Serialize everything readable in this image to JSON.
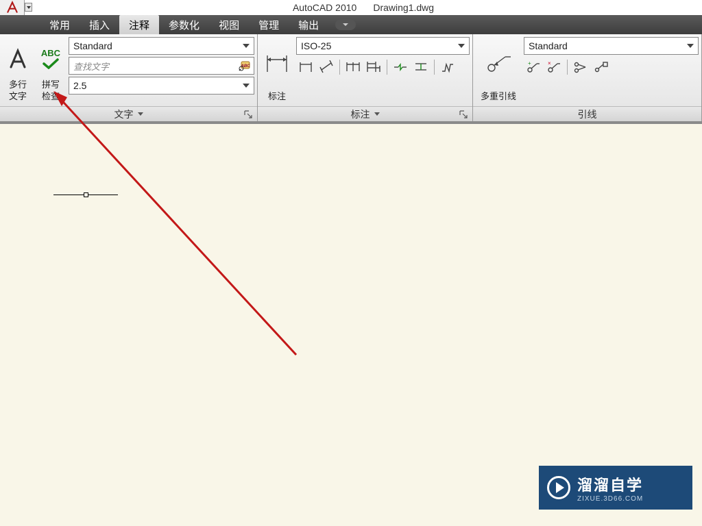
{
  "title": {
    "app": "AutoCAD 2010",
    "file": "Drawing1.dwg"
  },
  "menu": {
    "items": [
      "常用",
      "插入",
      "注释",
      "参数化",
      "视图",
      "管理",
      "输出"
    ],
    "active_index": 2
  },
  "panels": {
    "text": {
      "title": "文字",
      "mtext_label": "多行\n文字",
      "spell_label": "拼写\n检查",
      "spell_abc": "ABC",
      "style": "Standard",
      "search_placeholder": "查找文字",
      "height": "2.5"
    },
    "dim": {
      "title": "标注",
      "btn_label": "标注",
      "style": "ISO-25"
    },
    "leader": {
      "title": "引线",
      "btn_label": "多重引线",
      "style": "Standard"
    }
  },
  "watermark": {
    "main": "溜溜自学",
    "sub": "ZIXUE.3D66.COM"
  }
}
